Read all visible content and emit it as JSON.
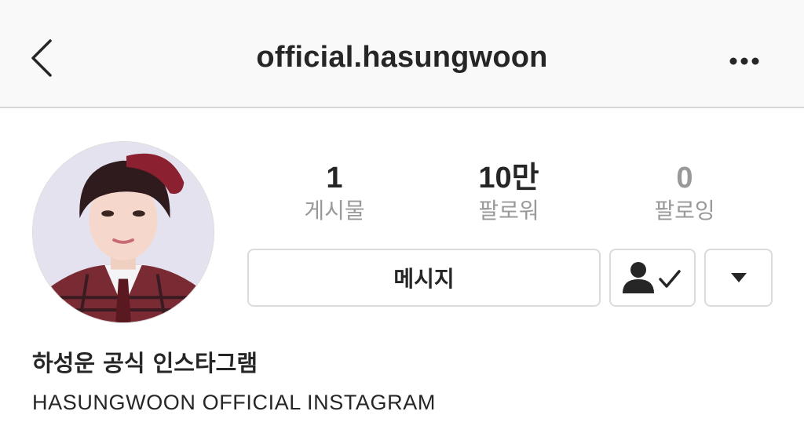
{
  "header": {
    "title": "official.hasungwoon",
    "back_icon": "chevron-left-icon",
    "more_icon": "more-horizontal-icon"
  },
  "profile": {
    "stats": [
      {
        "count": "1",
        "label": "게시물"
      },
      {
        "count": "10만",
        "label": "팔로워"
      },
      {
        "count": "0",
        "label": "팔로잉"
      }
    ],
    "name": "하성운 공식 인스타그램",
    "bio": "HASUNGWOON OFFICIAL INSTAGRAM"
  },
  "actions": {
    "message_label": "메시지",
    "following_icon": "person-check-icon",
    "dropdown_icon": "triangle-down-icon"
  }
}
